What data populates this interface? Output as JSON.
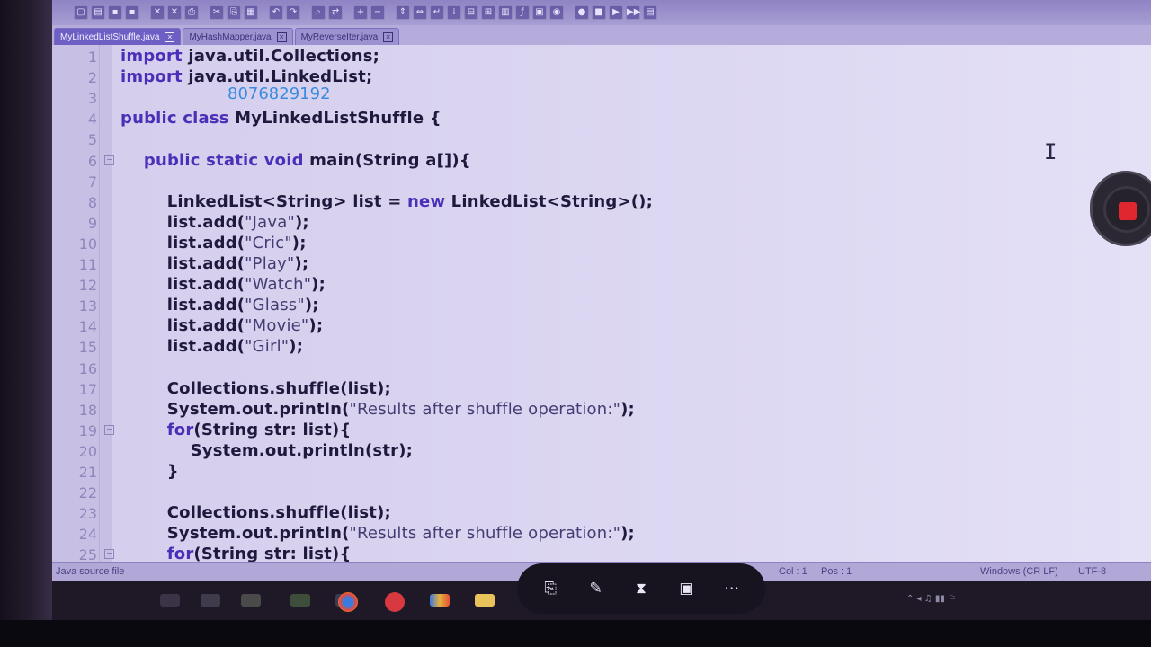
{
  "tabs": [
    {
      "label": "MyLinkedListShuffle.java",
      "active": true
    },
    {
      "label": "MyHashMapper.java",
      "active": false
    },
    {
      "label": "MyReverseIter.java",
      "active": false
    }
  ],
  "overlay_text": "8076829192",
  "code_lines": [
    {
      "n": "1",
      "fold": "",
      "html": "<span class=\"kw\">import</span> java.util.Collections;"
    },
    {
      "n": "2",
      "fold": "",
      "html": "<span class=\"kw\">import</span> java.util.LinkedList;"
    },
    {
      "n": "3",
      "fold": "",
      "html": ""
    },
    {
      "n": "4",
      "fold": "",
      "html": "<span class=\"kw\">public class</span> <span class=\"b\">MyLinkedListShuffle</span> {"
    },
    {
      "n": "5",
      "fold": "",
      "html": ""
    },
    {
      "n": "6",
      "fold": "−",
      "html": "    <span class=\"kw\">public static void</span> main(String a[]){"
    },
    {
      "n": "7",
      "fold": "",
      "html": ""
    },
    {
      "n": "8",
      "fold": "",
      "html": "        LinkedList&lt;String&gt; list = <span class=\"kw\">new</span> LinkedList&lt;String&gt;();"
    },
    {
      "n": "9",
      "fold": "",
      "html": "        list.add(<span class=\"str\">\"Java\"</span>);"
    },
    {
      "n": "10",
      "fold": "",
      "html": "        list.add(<span class=\"str\">\"Cric\"</span>);"
    },
    {
      "n": "11",
      "fold": "",
      "html": "        list.add(<span class=\"str\">\"Play\"</span>);"
    },
    {
      "n": "12",
      "fold": "",
      "html": "        list.add(<span class=\"str\">\"Watch\"</span>);"
    },
    {
      "n": "13",
      "fold": "",
      "html": "        list.add(<span class=\"str\">\"Glass\"</span>);"
    },
    {
      "n": "14",
      "fold": "",
      "html": "        list.add(<span class=\"str\">\"Movie\"</span>);"
    },
    {
      "n": "15",
      "fold": "",
      "html": "        list.add(<span class=\"str\">\"Girl\"</span>);"
    },
    {
      "n": "16",
      "fold": "",
      "html": ""
    },
    {
      "n": "17",
      "fold": "",
      "html": "        Collections.shuffle(list);"
    },
    {
      "n": "18",
      "fold": "",
      "html": "        System.out.println(<span class=\"str\">\"Results after shuffle operation:\"</span>);"
    },
    {
      "n": "19",
      "fold": "−",
      "html": "        <span class=\"kw\">for</span>(String str: list){"
    },
    {
      "n": "20",
      "fold": "",
      "html": "            System.out.println(str);"
    },
    {
      "n": "21",
      "fold": "",
      "html": "        }"
    },
    {
      "n": "22",
      "fold": "",
      "html": ""
    },
    {
      "n": "23",
      "fold": "",
      "html": "        Collections.shuffle(list);"
    },
    {
      "n": "24",
      "fold": "",
      "html": "        System.out.println(<span class=\"str\">\"Results after shuffle operation:\"</span>);"
    },
    {
      "n": "25",
      "fold": "−",
      "html": "        <span class=\"kw\">for</span>(String str: list){"
    }
  ],
  "statusbar": {
    "file_type": "Java source file",
    "col": "Col : 1",
    "pos": "Pos : 1",
    "eol": "Windows (CR LF)",
    "encoding": "UTF-8"
  },
  "toolbar_icons": [
    "new-icon",
    "open-icon",
    "save-icon",
    "save-all-icon",
    "close-icon",
    "close-all-icon",
    "print-icon",
    "cut-icon",
    "copy-icon",
    "paste-icon",
    "undo-icon",
    "redo-icon",
    "find-icon",
    "replace-icon",
    "zoom-in-icon",
    "zoom-out-icon",
    "sync-v-icon",
    "sync-h-icon",
    "wrap-icon",
    "indent-guide-icon",
    "fold-all-icon",
    "unfold-all-icon",
    "doc-map-icon",
    "function-list-icon",
    "folder-workspace-icon",
    "monitor-icon",
    "record-macro-icon",
    "stop-macro-icon",
    "play-macro-icon",
    "run-macro-multiple-icon",
    "save-macro-icon"
  ],
  "overlay_buttons": [
    "screenshot-icon",
    "draw-icon",
    "timer-icon",
    "gallery-icon",
    "more-icon"
  ],
  "colors": {
    "keyword": "#4b2fb8",
    "overlay_number": "#3a8be0",
    "record": "#e0262e"
  }
}
